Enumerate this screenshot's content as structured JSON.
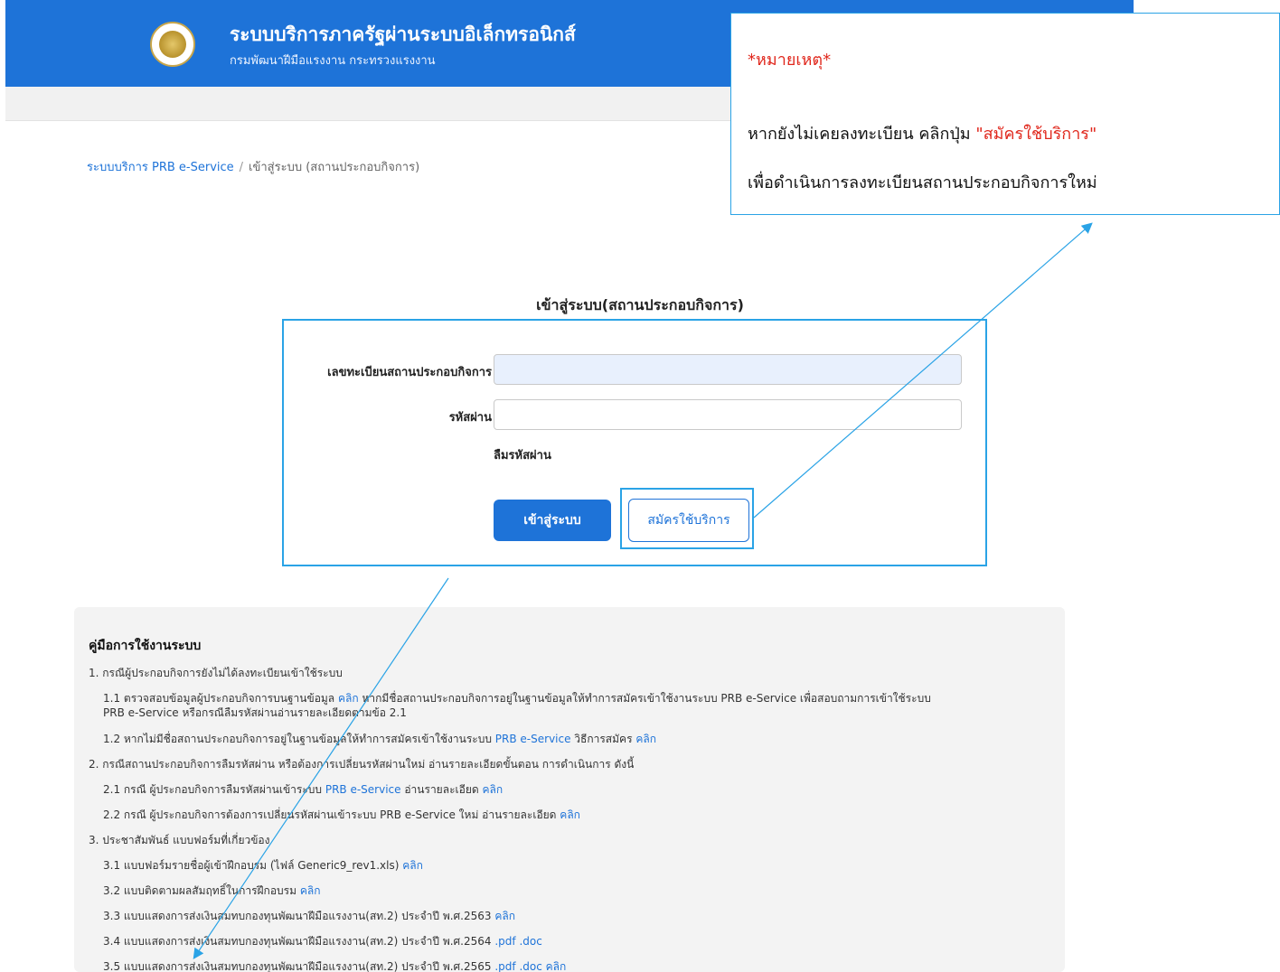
{
  "header": {
    "title": "ระบบบริการภาครัฐผ่านระบบอิเล็กทรอนิกส์",
    "subtitle": "กรมพัฒนาฝีมือแรงงาน กระทรวงแรงงาน"
  },
  "breadcrumb": {
    "home": "ระบบบริการ PRB e-Service",
    "separator": "/",
    "current": "เข้าสู่ระบบ (สถานประกอบกิจการ)"
  },
  "note": {
    "title": "*หมายเหตุ*",
    "line1_prefix": "หากยังไม่เคยลงทะเบียน คลิกปุ่ม ",
    "line1_highlight": "\"สมัครใช้บริการ\"",
    "line2": "เพื่อดำเนินการลงทะเบียนสถานประกอบกิจการใหม่"
  },
  "login": {
    "heading": "เข้าสู่ระบบ(สถานประกอบกิจการ)",
    "username_label": "เลขทะเบียนสถานประกอบกิจการ",
    "password_label": "รหัสผ่าน",
    "forgot_password": "ลืมรหัสผ่าน",
    "login_button": "เข้าสู่ระบบ",
    "register_button": "สมัครใช้บริการ"
  },
  "manual": {
    "title": "คู่มือการใช้งานระบบ",
    "items": [
      {
        "text": "1. กรณีผู้ประกอบกิจการยังไม่ได้ลงทะเบียนเข้าใช้ระบบ"
      },
      {
        "text": "1.1 ตรวจสอบข้อมูลผู้ประกอบกิจการบนฐานข้อมูล ",
        "link": "คลิก",
        "after": " หากมีชื่อสถานประกอบกิจการอยู่ในฐานข้อมูลให้ทำการสมัครเข้าใช้งานระบบ PRB e-Service เพื่อสอบถามการเข้าใช้ระบบ"
      },
      {
        "text": "PRB e-Service หรือกรณีลืมรหัสผ่านอ่านรายละเอียดตามข้อ 2.1"
      },
      {
        "text": "1.2 หากไม่มีชื่อสถานประกอบกิจการอยู่ในฐานข้อมูลให้ทำการสมัครเข้าใช้งานระบบ ",
        "link": "PRB e-Service",
        "after": " วิธีการสมัคร ",
        "link2": "คลิก"
      },
      {
        "text": "2. กรณีสถานประกอบกิจการลืมรหัสผ่าน หรือต้องการเปลี่ยนรหัสผ่านใหม่ อ่านรายละเอียดขั้นตอน การดำเนินการ ดังนี้"
      },
      {
        "text": "2.1 กรณี ผู้ประกอบกิจการลืมรหัสผ่านเข้าระบบ ",
        "link": "PRB e-Service",
        "after": " อ่านรายละเอียด ",
        "link2": "คลิก"
      },
      {
        "text": "2.2 กรณี ผู้ประกอบกิจการต้องการเปลี่ยนรหัสผ่านเข้าระบบ PRB e-Service ใหม่ อ่านรายละเอียด ",
        "link": "คลิก"
      },
      {
        "text": "3. ประชาสัมพันธ์ แบบฟอร์มที่เกี่ยวข้อง"
      },
      {
        "text": "3.1 แบบฟอร์มรายชื่อผู้เข้าฝึกอบรม (ไฟล์ Generic9_rev1.xls) ",
        "link": "คลิก"
      },
      {
        "text": "3.2 แบบติดตามผลสัมฤทธิ์ในการฝึกอบรม ",
        "link": "คลิก"
      },
      {
        "text": "3.3 แบบแสดงการส่งเงินสมทบกองทุนพัฒนาฝีมือแรงงาน(สท.2) ประจำปี พ.ศ.2563 ",
        "link": "คลิก"
      },
      {
        "text": "3.4 แบบแสดงการส่งเงินสมทบกองทุนพัฒนาฝีมือแรงงาน(สท.2) ประจำปี พ.ศ.2564 ",
        "link": ".pdf",
        "after": " ",
        "link2": ".doc"
      },
      {
        "text": "3.5 แบบแสดงการส่งเงินสมทบกองทุนพัฒนาฝีมือแรงงาน(สท.2) ประจำปี พ.ศ.2565 ",
        "link": ".pdf",
        "after": " ",
        "link2": ".doc",
        "after2": " ",
        "link3": "คลิก"
      }
    ]
  },
  "colors": {
    "brand": "#1e73d8",
    "annotation": "#2aa3e6",
    "note_red": "#e0271c"
  }
}
